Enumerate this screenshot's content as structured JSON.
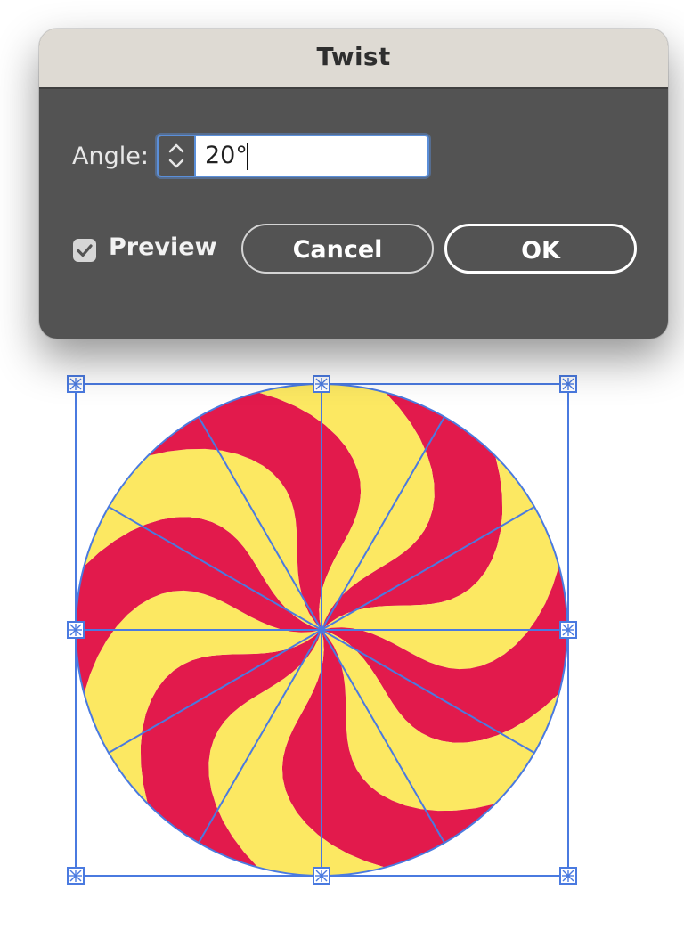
{
  "dialog": {
    "title": "Twist",
    "angle_label": "Angle:",
    "angle_value": "20°",
    "preview_label": "Preview",
    "preview_checked": true,
    "cancel_label": "Cancel",
    "ok_label": "OK"
  },
  "artwork": {
    "description_shape": "pinwheel-circle",
    "segments": 12,
    "twist_angle_degrees": 20,
    "colors": {
      "red": "#e21a4c",
      "yellow": "#fce862",
      "selection": "#4a7ae0",
      "dialog_body": "#535353",
      "dialog_titlebar": "#dedad3"
    }
  }
}
